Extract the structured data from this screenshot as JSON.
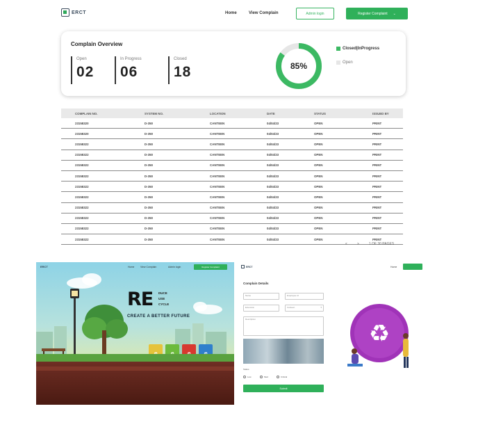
{
  "nav": {
    "logo_text": "ERCT",
    "links": [
      "Home",
      "View Complain"
    ],
    "outline_button": "Admin login",
    "green_button": "Register Complaint"
  },
  "overview": {
    "title": "Complain Overview",
    "stats": [
      {
        "label": "Open",
        "value": "02"
      },
      {
        "label": "In Progress",
        "value": "06"
      },
      {
        "label": "Closed",
        "value": "18"
      }
    ],
    "donut_label": "85%",
    "donut_fraction": 0.85,
    "legend": [
      {
        "label": "Closed|InProgress",
        "color": "#3cb963"
      },
      {
        "label": "Open",
        "color": "#e6e6e6"
      }
    ]
  },
  "table": {
    "headers": [
      "COMPLAIN NO.",
      "SYSTEM NO.",
      "LOCATION",
      "DATE",
      "STATUS",
      "ISSUED BY"
    ],
    "rows": [
      [
        "23158320",
        "D-350",
        "CANTEEN",
        "04/04/23",
        "OPEN",
        "PRINT"
      ],
      [
        "23158320",
        "D-350",
        "CANTEEN",
        "04/04/23",
        "OPEN",
        "PRINT"
      ],
      [
        "23158322",
        "D-350",
        "CANTEEN",
        "04/04/23",
        "OPEN",
        "PRINT"
      ],
      [
        "23158322",
        "D-350",
        "CANTEEN",
        "04/04/23",
        "OPEN",
        "PRINT"
      ],
      [
        "23158322",
        "D-350",
        "CANTEEN",
        "04/04/23",
        "OPEN",
        "PRINT"
      ],
      [
        "23158322",
        "D-350",
        "CANTEEN",
        "04/04/23",
        "OPEN",
        "PRINT"
      ],
      [
        "23158322",
        "D-350",
        "CANTEEN",
        "04/04/23",
        "OPEN",
        "PRINT"
      ],
      [
        "23158322",
        "D-350",
        "CANTEEN",
        "04/04/23",
        "OPEN",
        "PRINT"
      ],
      [
        "23158322",
        "D-350",
        "CANTEEN",
        "04/04/23",
        "OPEN",
        "PRINT"
      ],
      [
        "23158322",
        "D-350",
        "CANTEEN",
        "04/04/23",
        "OPEN",
        "PRINT"
      ],
      [
        "23158322",
        "D-350",
        "CANTEEN",
        "04/04/23",
        "OPEN",
        "PRINT"
      ],
      [
        "23158322",
        "D-350",
        "CANTEEN",
        "04/04/23",
        "OPEN",
        "PRINT"
      ]
    ],
    "pager": {
      "prev": "<",
      "next": ">",
      "info": "1 OF 30 PAGES"
    }
  },
  "landing": {
    "nav_logo": "ERCT",
    "nav_links": [
      "Home",
      "View Complain",
      "Admin login"
    ],
    "nav_button": "Register Complaint",
    "hero_big": "RE",
    "hero_words": [
      "DUCE",
      "USE",
      "CYCLE"
    ],
    "tagline": "CREATE A BETTER FUTURE"
  },
  "form": {
    "logo": "ERCT",
    "home": "Home",
    "title": "Complain Details",
    "fields": [
      "Name",
      "Employee Id",
      "Extension",
      "Location",
      "Description"
    ],
    "select_value": "Canteen",
    "radio_label": "Status",
    "radios": [
      "Low",
      "Med",
      "Critical"
    ],
    "submit": "Submit"
  },
  "colors": {
    "accent": "#2fb05a"
  }
}
